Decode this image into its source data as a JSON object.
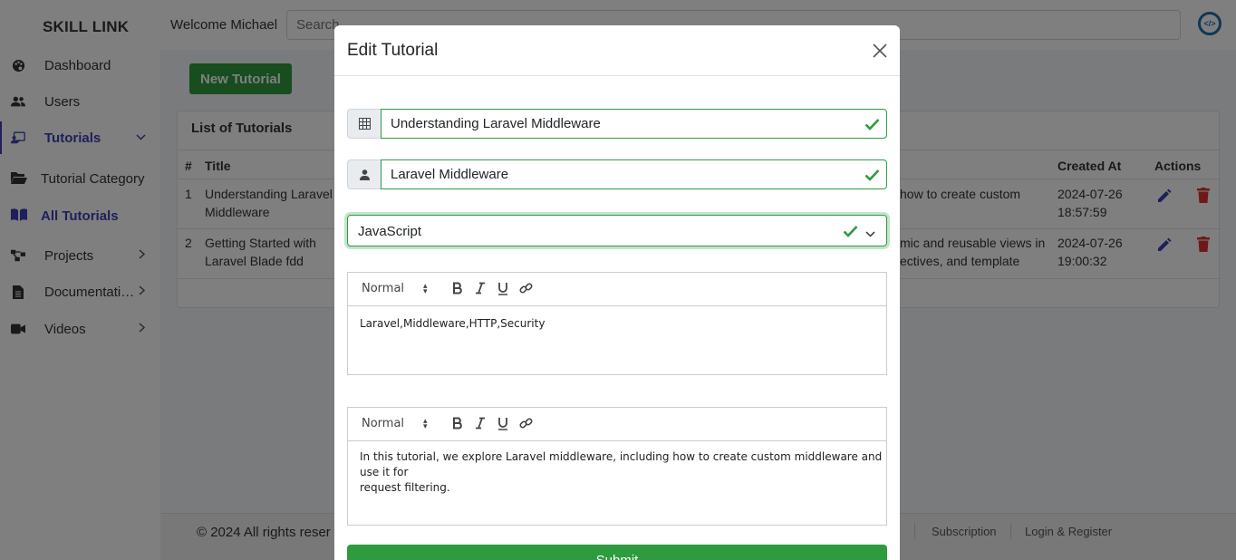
{
  "brand": "SKILL LINK",
  "sidebar": {
    "items": [
      {
        "label": "Dashboard"
      },
      {
        "label": "Users"
      },
      {
        "label": "Tutorials"
      },
      {
        "label": "Tutorial Category"
      },
      {
        "label": "All Tutorials"
      },
      {
        "label": "Projects"
      },
      {
        "label": "Documentati…"
      },
      {
        "label": "Videos"
      }
    ]
  },
  "header": {
    "welcome": "Welcome Michael",
    "search_placeholder": "Search"
  },
  "page": {
    "new_button": "New Tutorial",
    "list_title": "List of Tutorials",
    "columns": [
      "#",
      "Title",
      "Created At",
      "Actions"
    ],
    "rows": [
      {
        "num": "1",
        "title_l1": "Understanding Laravel",
        "title_l2": "Middleware",
        "desc_l1": "how to create custom",
        "desc_l2": "",
        "created_l1": "2024-07-26",
        "created_l2": "18:57:59"
      },
      {
        "num": "2",
        "title_l1": "Getting Started with",
        "title_l2": "Laravel Blade fdd",
        "desc_l1": "mic and reusable views in",
        "desc_l2": "ectives, and template",
        "created_l1": "2024-07-26",
        "created_l2": "19:00:32"
      }
    ]
  },
  "footer": {
    "copyright": "© 2024    All rights reser",
    "links": [
      "Subscription",
      "Login & Register"
    ]
  },
  "modal": {
    "title": "Edit Tutorial",
    "title_field": "Understanding Laravel Middleware",
    "subtitle_field": "Laravel Middleware",
    "category_select": "JavaScript",
    "editor1": {
      "format": "Normal",
      "content": "Laravel,Middleware,HTTP,Security"
    },
    "editor2": {
      "format": "Normal",
      "content_l1": "In this tutorial, we explore Laravel middleware, including how to create custom middleware and use it for",
      "content_l2": "request filtering."
    },
    "submit": "Submit"
  },
  "colors": {
    "accent": "#3d3fb8",
    "success": "#2e9b3f",
    "danger": "#d33"
  }
}
